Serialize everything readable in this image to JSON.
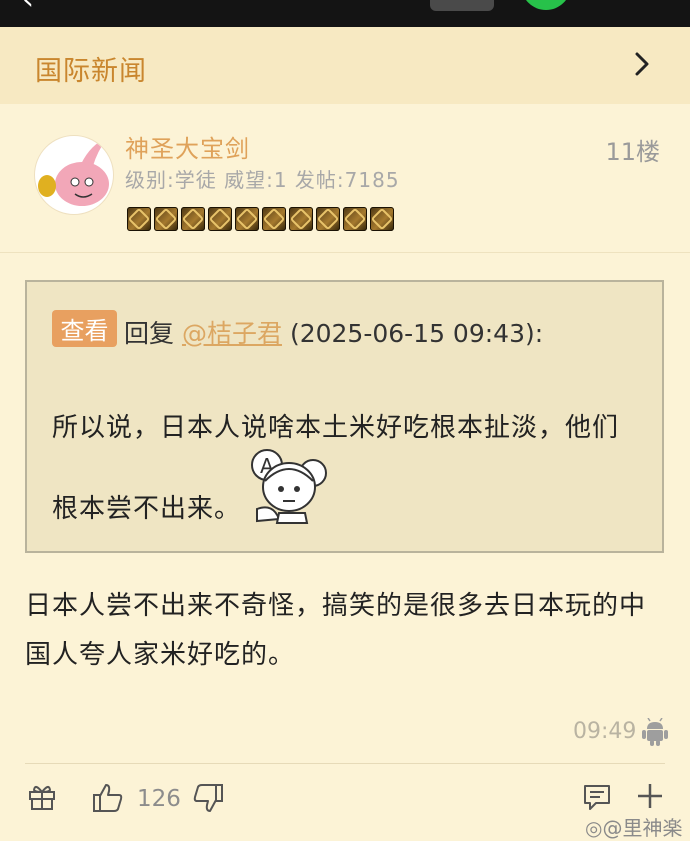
{
  "section": {
    "title": "国际新闻"
  },
  "post": {
    "username": "神圣大宝剑",
    "floor": "11楼",
    "meta": "级别:学徒 威望:1 发帖:7185",
    "badge_count": 10,
    "quote": {
      "view_label": "查看",
      "reply_prefix": "回复",
      "mention": "@桔子君",
      "timestamp": "(2025-06-15 09:43):",
      "line1": "所以说，日本人说啥本土米好吃根本扯淡，他们",
      "line2": "根本尝不出来。"
    },
    "body_line1": "日本人尝不出来不奇怪，搞笑的是很多去日本玩的中",
    "body_line2": "国人夸人家米好吃的。",
    "time": "09:49",
    "likes": "126"
  },
  "watermark": "@里神楽",
  "colors": {
    "username": "#dfa25a",
    "section_title": "#c9862e",
    "view_button": "#e8a060"
  }
}
